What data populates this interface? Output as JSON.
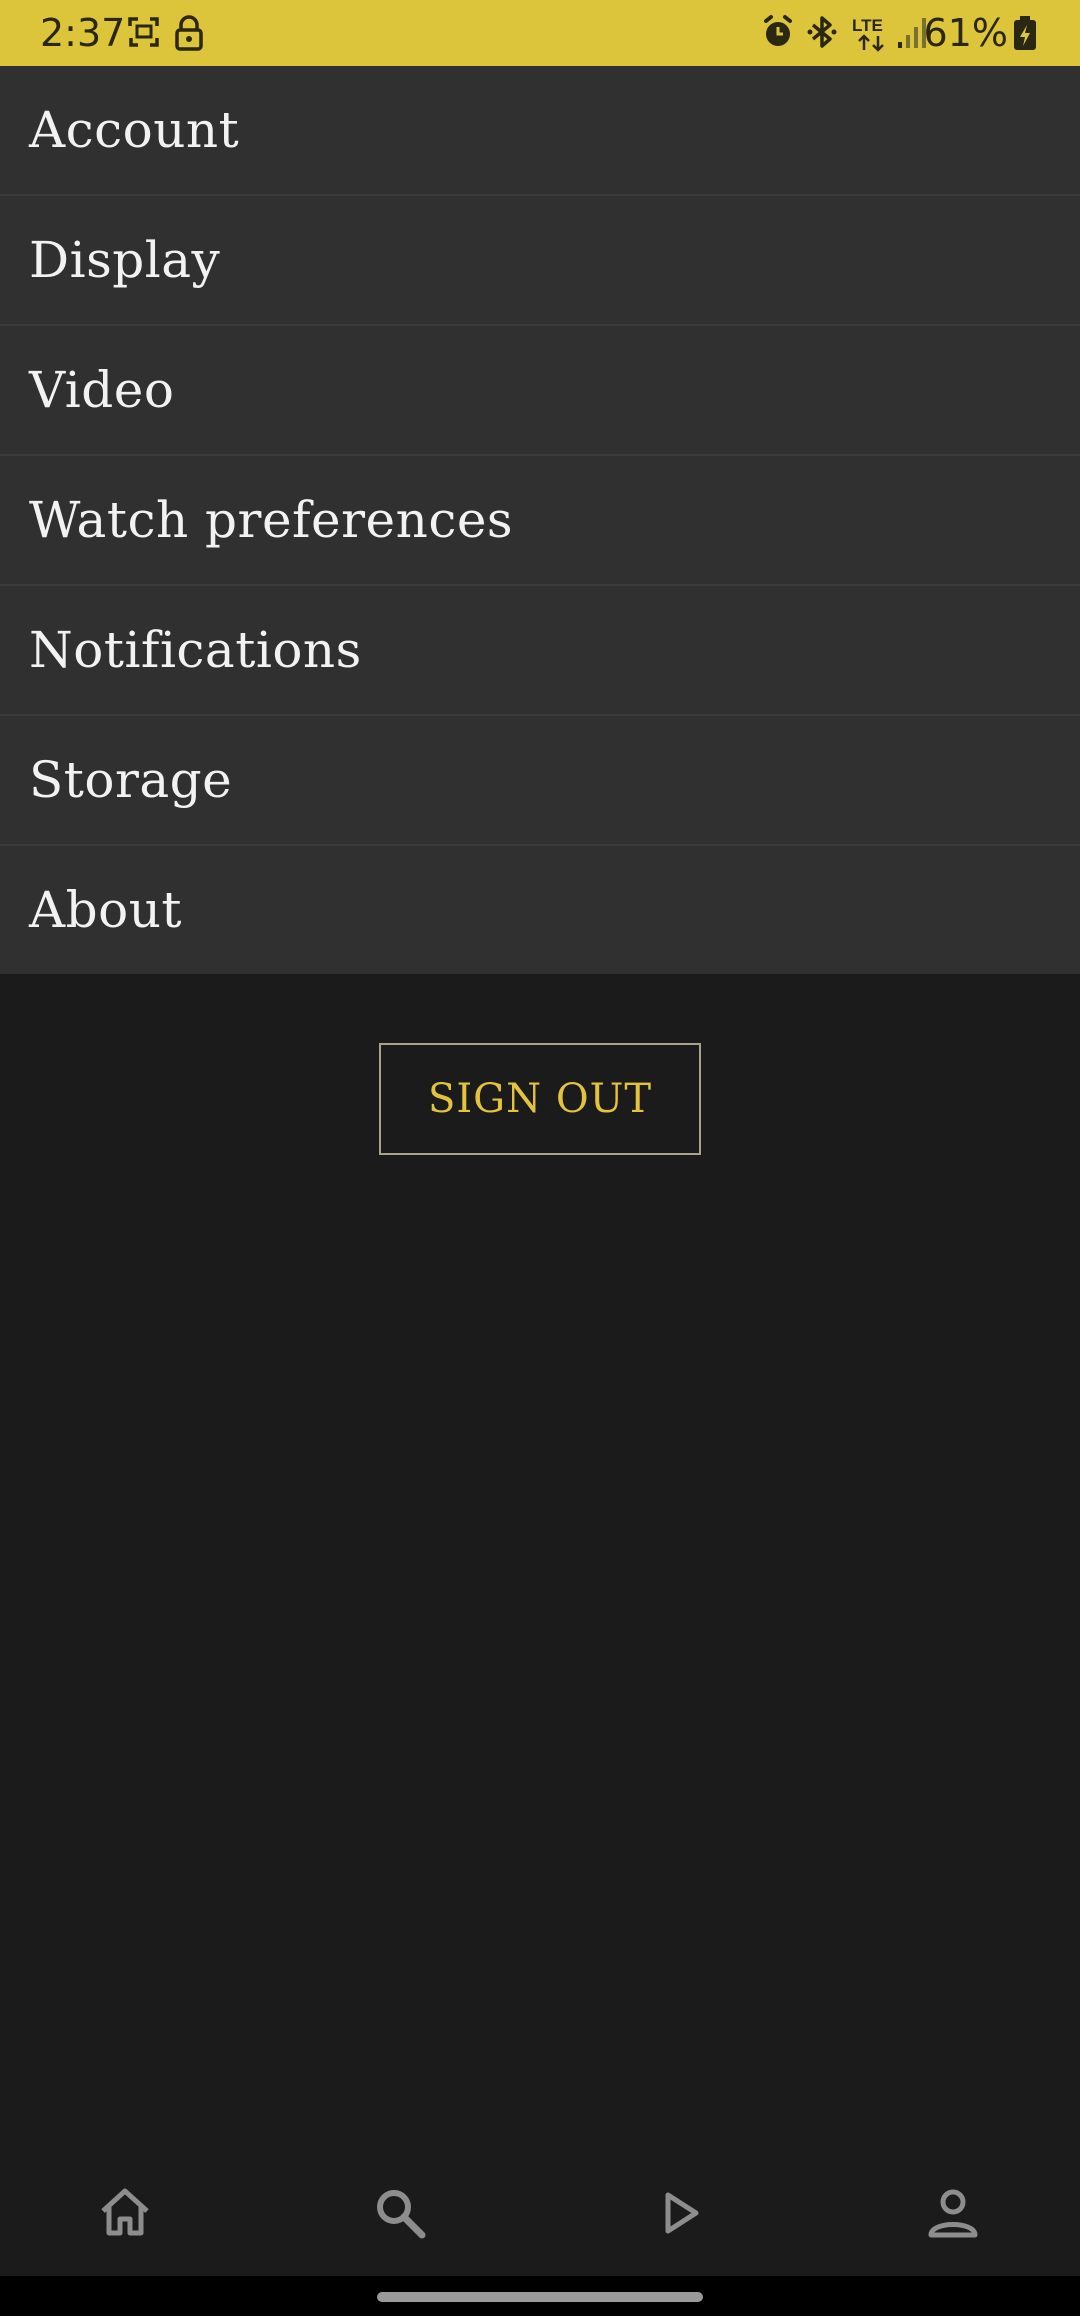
{
  "status_bar": {
    "time": "2:37",
    "battery": "61%",
    "network": "LTE",
    "accent_color": "#dcc53b",
    "icons": [
      "screenshot-icon",
      "lock-icon",
      "alarm-icon",
      "bluetooth-icon",
      "lte-icon",
      "signal-icon",
      "battery-charging-icon"
    ]
  },
  "menu": {
    "items": [
      {
        "label": "Account"
      },
      {
        "label": "Display"
      },
      {
        "label": "Video"
      },
      {
        "label": "Watch preferences"
      },
      {
        "label": "Notifications"
      },
      {
        "label": "Storage"
      },
      {
        "label": "About"
      }
    ]
  },
  "sign_out": {
    "label": "SIGN OUT",
    "color": "#e3c33d"
  },
  "bottom_nav": {
    "items": [
      {
        "icon": "home-icon"
      },
      {
        "icon": "search-icon"
      },
      {
        "icon": "play-icon"
      },
      {
        "icon": "profile-icon"
      }
    ]
  }
}
